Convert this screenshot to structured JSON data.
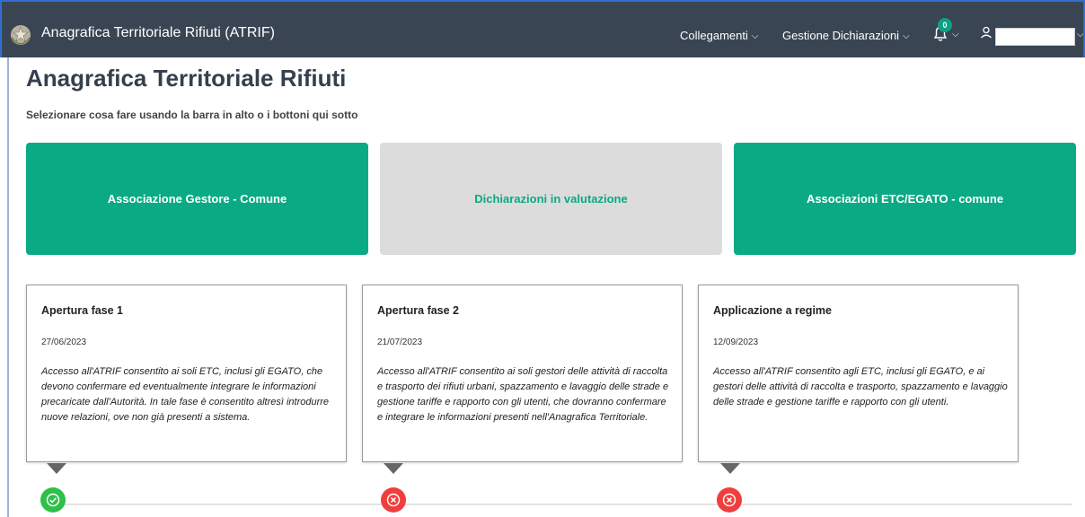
{
  "navbar": {
    "app_title": "Anagrafica Territoriale Rifiuti (ATRIF)",
    "menu": [
      {
        "label": "Collegamenti"
      },
      {
        "label": "Gestione Dichiarazioni"
      }
    ],
    "notifications_count": "0",
    "icons": [
      "emblem-logo",
      "bell-icon",
      "user-icon",
      "chevron-down-icon"
    ]
  },
  "page": {
    "title": "Anagrafica Territoriale Rifiuti",
    "subtitle": "Selezionare cosa fare usando la barra in alto o i bottoni qui sotto"
  },
  "actions": [
    {
      "label": "Associazione Gestore - Comune",
      "style": "green"
    },
    {
      "label": "Dichiarazioni in valutazione",
      "style": "grey"
    },
    {
      "label": "Associazioni ETC/EGATO - comune",
      "style": "green"
    }
  ],
  "phases": [
    {
      "title": "Apertura fase 1",
      "date": "27/06/2023",
      "description": "Accesso all'ATRIF consentito ai soli ETC, inclusi gli EGATO, che devono confermare ed eventualmente integrare le informazioni precaricate dall'Autorità. In tale fase è consentito altresì introdurre nuove relazioni, ove non già presenti a sistema.",
      "status": "completed",
      "status_icon": "check-circle-icon"
    },
    {
      "title": "Apertura fase 2",
      "date": "21/07/2023",
      "description": "Accesso all'ATRIF consentito ai soli gestori delle attività di raccolta e trasporto dei rifiuti urbani, spazzamento e lavaggio delle strade e gestione tariffe e rapporto con gli utenti, che dovranno confermare e integrare le informazioni presenti nell'Anagrafica Territoriale.",
      "status": "not-completed",
      "status_icon": "x-circle-icon"
    },
    {
      "title": "Applicazione a regime",
      "date": "12/09/2023",
      "description": "Accesso all'ATRIF consentito agli ETC, inclusi gli EGATO, e ai gestori delle attività di raccolta e trasporto, spazzamento e lavaggio delle strade e gestione tariffe e rapporto con gli utenti.",
      "status": "not-completed",
      "status_icon": "x-circle-icon"
    }
  ],
  "colors": {
    "navbar_bg": "#3a4553",
    "accent_green": "#0aaa84",
    "grey_card": "#dcdcdc",
    "status_green": "#2fbf4a",
    "status_red": "#ef3e3e"
  }
}
